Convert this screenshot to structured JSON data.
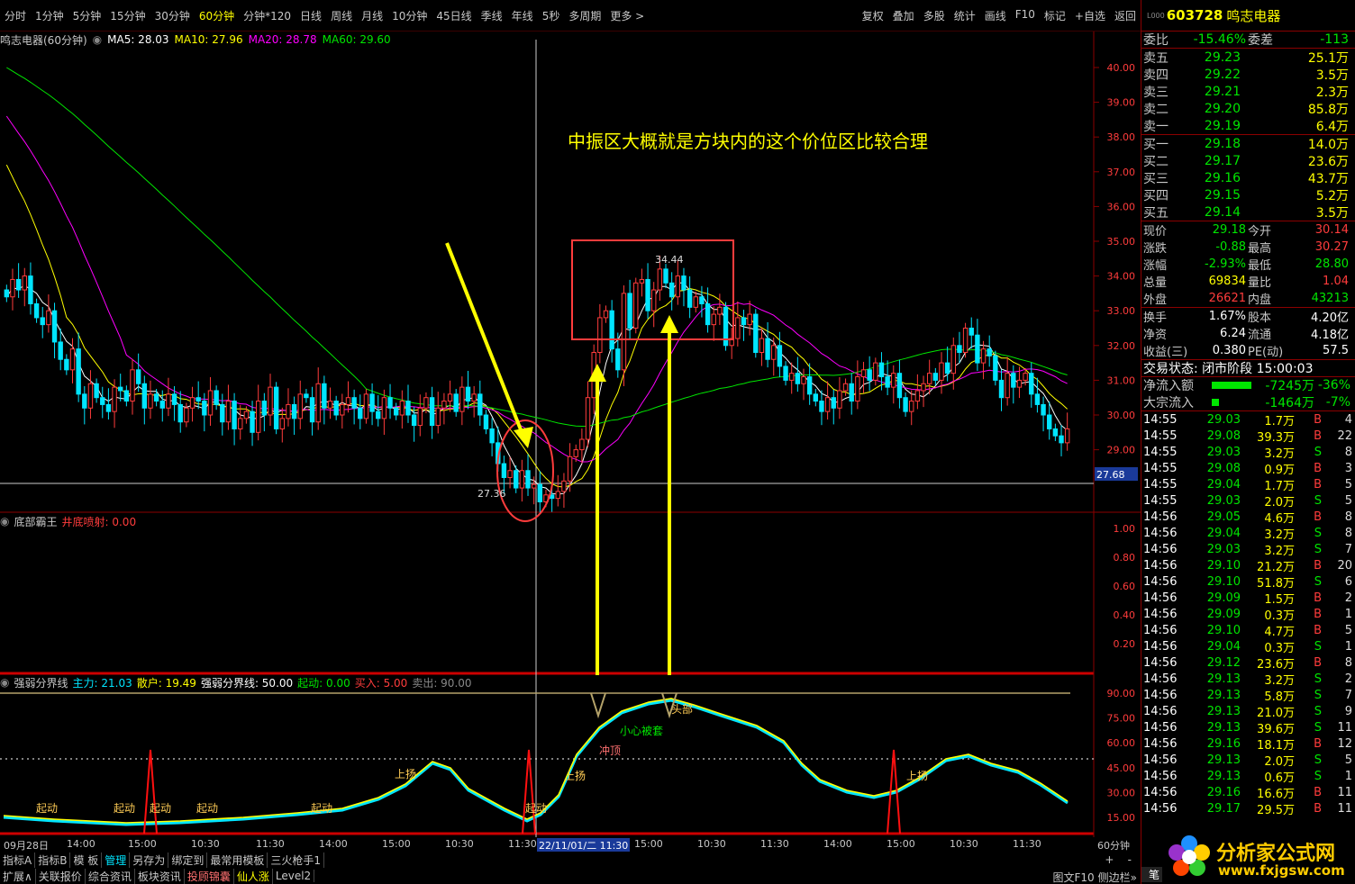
{
  "toolbar": {
    "periods": [
      "分时",
      "1分钟",
      "5分钟",
      "15分钟",
      "30分钟",
      "60分钟",
      "分钟*120",
      "日线",
      "周线",
      "月线",
      "10分钟",
      "45日线",
      "季线",
      "年线",
      "5秒",
      "多周期",
      "更多 >"
    ],
    "active_period": "60分钟",
    "tools": [
      "复权",
      "叠加",
      "多股",
      "统计",
      "画线",
      "F10",
      "标记",
      "+自选",
      "返回"
    ]
  },
  "main_chart": {
    "stock_label": "鸣志电器(60分钟)",
    "ma5": "MA5: 28.03",
    "ma10": "MA10: 27.96",
    "ma20": "MA20: 28.78",
    "ma60": "MA60: 29.60",
    "price_axis": [
      "40.00",
      "39.00",
      "38.00",
      "37.00",
      "36.00",
      "35.00",
      "34.00",
      "33.00",
      "32.00",
      "31.00",
      "30.00",
      "29.00"
    ],
    "current_tag": "27.68",
    "annotation": "中振区大概就是方块内的这个价位区比较合理",
    "high_label": "34.44",
    "low_label": "27.36",
    "colors": {
      "ma5": "#ffffff",
      "ma10": "#ffff00",
      "ma20": "#ff00ff",
      "ma60": "#00e600",
      "up": "#ff3c3c",
      "down": "#00e5ff"
    }
  },
  "indicator1": {
    "name": "底部霸王",
    "param": "井底喷射: 0.00",
    "axis": [
      "1.00",
      "0.80",
      "0.60",
      "0.40",
      "0.20"
    ]
  },
  "indicator2": {
    "name": "强弱分界线",
    "main": "主力: 21.03",
    "retail": "散户: 19.49",
    "line": "强弱分界线: 50.00",
    "start": "起动: 0.00",
    "buy": "买入: 5.00",
    "sell": "卖出: 90.00",
    "axis": [
      "90.00",
      "75.00",
      "60.00",
      "45.00",
      "30.00",
      "15.00"
    ],
    "labels": {
      "qidong": "起动",
      "shangyang": "上扬",
      "chongding": "冲顶",
      "xiaoxin": "小心被套",
      "tuobu": "头部"
    }
  },
  "xaxis": {
    "labels": [
      "09月28日",
      "14:00",
      "15:00",
      "10:30",
      "11:30",
      "14:00",
      "15:00",
      "10:30",
      "11:30",
      "22/11/01/二 11:30",
      "15:00",
      "10:30",
      "11:30",
      "14:00",
      "15:00",
      "10:30",
      "11:30"
    ],
    "period": "60分钟"
  },
  "bottom_tabs": {
    "row1": [
      "指标A",
      "指标B",
      "模 板",
      "管理",
      "另存为",
      "绑定到",
      "最常用模板",
      "三火枪手1"
    ],
    "row2": [
      "扩展∧",
      "关联报价",
      "综合资讯",
      "板块资讯",
      "投顾锦囊",
      "仙人涨",
      "Level2"
    ],
    "right": [
      "图文F10",
      "侧边栏»"
    ],
    "plus": "+",
    "minus": "-"
  },
  "quote": {
    "code": "603728",
    "name": "鸣志电器",
    "small": "L000",
    "weibi_label": "委比",
    "weibi": "-15.46%",
    "weicha_label": "委差",
    "weicha": "-113",
    "sell": [
      {
        "l": "卖五",
        "p": "29.23",
        "v": "25.1万"
      },
      {
        "l": "卖四",
        "p": "29.22",
        "v": "3.5万"
      },
      {
        "l": "卖三",
        "p": "29.21",
        "v": "2.3万"
      },
      {
        "l": "卖二",
        "p": "29.20",
        "v": "85.8万"
      },
      {
        "l": "卖一",
        "p": "29.19",
        "v": "6.4万"
      }
    ],
    "buy": [
      {
        "l": "买一",
        "p": "29.18",
        "v": "14.0万"
      },
      {
        "l": "买二",
        "p": "29.17",
        "v": "23.6万"
      },
      {
        "l": "买三",
        "p": "29.16",
        "v": "43.7万"
      },
      {
        "l": "买四",
        "p": "29.15",
        "v": "5.2万"
      },
      {
        "l": "买五",
        "p": "29.14",
        "v": "3.5万"
      }
    ],
    "stats": [
      {
        "l1": "现价",
        "v1": "29.18",
        "l2": "今开",
        "v2": "30.14"
      },
      {
        "l1": "涨跌",
        "v1": "-0.88",
        "l2": "最高",
        "v2": "30.27"
      },
      {
        "l1": "涨幅",
        "v1": "-2.93%",
        "l2": "最低",
        "v2": "28.80"
      },
      {
        "l1": "总量",
        "v1": "69834",
        "l2": "量比",
        "v2": "1.04"
      },
      {
        "l1": "外盘",
        "v1": "26621",
        "l2": "内盘",
        "v2": "43213"
      }
    ],
    "stats2": [
      {
        "l1": "换手",
        "v1": "1.67%",
        "l2": "股本",
        "v2": "4.20亿"
      },
      {
        "l1": "净资",
        "v1": "6.24",
        "l2": "流通",
        "v2": "4.18亿"
      },
      {
        "l1": "收益(三)",
        "v1": "0.380",
        "l2": "PE(动)",
        "v2": "57.5"
      }
    ],
    "status": "交易状态: 闭市阶段 15:00:03",
    "netflow": {
      "label": "净流入额",
      "value": "-7245万",
      "pct": "-36%"
    },
    "blockflow": {
      "label": "大宗流入",
      "value": "-1464万",
      "pct": "-7%"
    },
    "ticks": [
      [
        "14:55",
        "29.03",
        "1.7万",
        "B",
        "4"
      ],
      [
        "14:55",
        "29.08",
        "39.3万",
        "B",
        "22"
      ],
      [
        "14:55",
        "29.03",
        "3.2万",
        "S",
        "8"
      ],
      [
        "14:55",
        "29.08",
        "0.9万",
        "B",
        "3"
      ],
      [
        "14:55",
        "29.04",
        "1.7万",
        "B",
        "5"
      ],
      [
        "14:55",
        "29.03",
        "2.0万",
        "S",
        "5"
      ],
      [
        "14:56",
        "29.05",
        "4.6万",
        "B",
        "8"
      ],
      [
        "14:56",
        "29.04",
        "3.2万",
        "S",
        "8"
      ],
      [
        "14:56",
        "29.03",
        "3.2万",
        "S",
        "7"
      ],
      [
        "14:56",
        "29.10",
        "21.2万",
        "B",
        "20"
      ],
      [
        "14:56",
        "29.10",
        "51.8万",
        "S",
        "6"
      ],
      [
        "14:56",
        "29.09",
        "1.5万",
        "B",
        "2"
      ],
      [
        "14:56",
        "29.09",
        "0.3万",
        "B",
        "1"
      ],
      [
        "14:56",
        "29.10",
        "4.7万",
        "B",
        "5"
      ],
      [
        "14:56",
        "29.04",
        "0.3万",
        "S",
        "1"
      ],
      [
        "14:56",
        "29.12",
        "23.6万",
        "B",
        "8"
      ],
      [
        "14:56",
        "29.13",
        "3.2万",
        "S",
        "2"
      ],
      [
        "14:56",
        "29.13",
        "5.8万",
        "S",
        "7"
      ],
      [
        "14:56",
        "29.13",
        "21.0万",
        "S",
        "9"
      ],
      [
        "14:56",
        "29.13",
        "39.6万",
        "S",
        "11"
      ],
      [
        "14:56",
        "29.16",
        "18.1万",
        "B",
        "12"
      ],
      [
        "14:56",
        "29.13",
        "2.0万",
        "S",
        "5"
      ],
      [
        "14:56",
        "29.13",
        "0.6万",
        "S",
        "1"
      ],
      [
        "14:56",
        "29.16",
        "16.6万",
        "B",
        "11"
      ],
      [
        "14:56",
        "29.17",
        "29.5万",
        "B",
        "11"
      ]
    ],
    "footer_tab": "笔"
  },
  "watermark": {
    "title": "分析家公式网",
    "url": "www.fxjgsw.com"
  }
}
